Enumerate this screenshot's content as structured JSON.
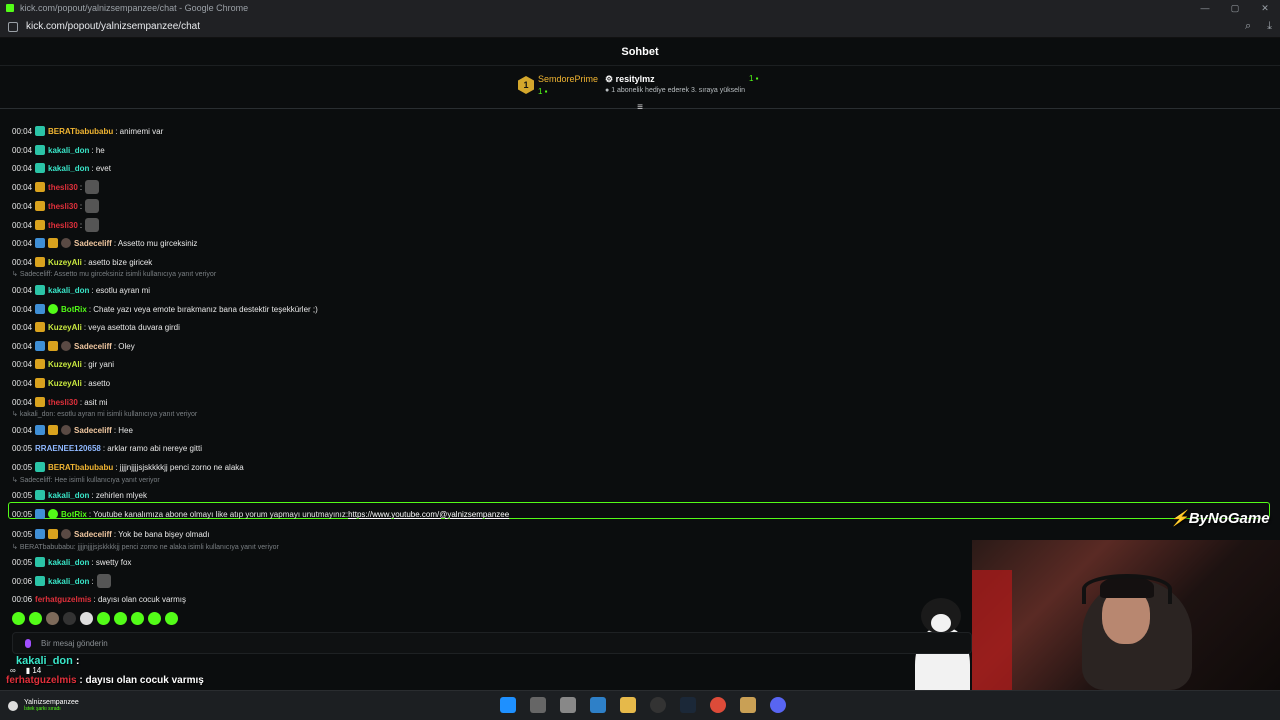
{
  "window": {
    "title": "kick.com/popout/yalnizsempanzee/chat - Google Chrome"
  },
  "browser": {
    "url": "kick.com/popout/yalnizsempanzee/chat",
    "zoom_icon": "zoom-icon",
    "download_icon": "download-icon"
  },
  "chat": {
    "title": "Sohbet",
    "pinned": {
      "rank": "1",
      "first_user": "SemdorePrime",
      "first_count": "1",
      "second_user": "resitylmz",
      "second_count": "1",
      "gift_hint": "1 abonelik hediye ederek 3. sıraya yükselin"
    },
    "messages": [
      {
        "time": "00:04",
        "user": "BERATbabubabu",
        "color": "#f1b532",
        "text": ": animemi var",
        "badges": [
          "sub"
        ]
      },
      {
        "time": "00:04",
        "user": "kakali_don",
        "color": "#39e6c9",
        "text": ": he",
        "badges": [
          "sub"
        ]
      },
      {
        "time": "00:04",
        "user": "kakali_don",
        "color": "#39e6c9",
        "text": ": evet",
        "badges": [
          "sub"
        ]
      },
      {
        "time": "00:04",
        "user": "thesli30",
        "color": "#e0303b",
        "text": ":",
        "badges": [
          "crown"
        ],
        "emote": true
      },
      {
        "time": "00:04",
        "user": "thesli30",
        "color": "#e0303b",
        "text": ":",
        "badges": [
          "crown"
        ],
        "emote": true
      },
      {
        "time": "00:04",
        "user": "thesli30",
        "color": "#e0303b",
        "text": ":",
        "badges": [
          "crown"
        ],
        "emote": true
      },
      {
        "time": "00:04",
        "user": "Sadeceliff",
        "color": "#f0c7a0",
        "text": ": Assetto mu girceksiniz",
        "badges": [
          "mod",
          "crown",
          "av"
        ]
      },
      {
        "time": "00:04",
        "user": "KuzeyAli",
        "color": "#c8e83f",
        "text": ": asetto bize giricek",
        "badges": [
          "crown"
        ]
      },
      {
        "time": "00:04",
        "user": "kakali_don",
        "color": "#39e6c9",
        "text": ": esotlu ayran mi",
        "badges": [
          "sub"
        ]
      },
      {
        "time": "00:04",
        "user": "BotRix",
        "color": "#53fc18",
        "text": ": Chate yazı veya emote bırakmanız bana destektir teşekkürler ;)",
        "badges": [
          "mod",
          "bot"
        ]
      },
      {
        "time": "00:04",
        "user": "KuzeyAli",
        "color": "#c8e83f",
        "text": ": veya asettota duvara girdi",
        "badges": [
          "crown"
        ]
      },
      {
        "time": "00:04",
        "user": "Sadeceliff",
        "color": "#f0c7a0",
        "text": ": Oley",
        "badges": [
          "mod",
          "crown",
          "av"
        ]
      },
      {
        "time": "00:04",
        "user": "KuzeyAli",
        "color": "#c8e83f",
        "text": ": gir yani",
        "badges": [
          "crown"
        ]
      },
      {
        "time": "00:04",
        "user": "KuzeyAli",
        "color": "#c8e83f",
        "text": ": asetto",
        "badges": [
          "crown"
        ]
      },
      {
        "time": "00:04",
        "user": "thesli30",
        "color": "#e0303b",
        "text": ": asit mi",
        "badges": [
          "crown"
        ]
      },
      {
        "time": "00:04",
        "user": "Sadeceliff",
        "color": "#f0c7a0",
        "text": ": Hee",
        "badges": [
          "mod",
          "crown",
          "av"
        ]
      },
      {
        "time": "00:05",
        "user": "RRAENEE120658",
        "color": "#8fb8ff",
        "text": ": arklar ramo abi nereye gitti",
        "badges": []
      },
      {
        "time": "00:05",
        "user": "BERATbabubabu",
        "color": "#f1b532",
        "text": ": jjjjnjjjjsjskkkkjj penci zorno ne alaka",
        "badges": [
          "sub"
        ]
      },
      {
        "time": "00:05",
        "user": "kakali_don",
        "color": "#39e6c9",
        "text": ": zehirlen mlyek",
        "badges": [
          "sub"
        ]
      },
      {
        "time": "00:05",
        "user": "BotRix",
        "color": "#53fc18",
        "text": ": Youtube kanalımıza abone olmayı like atıp yorum yapmayı unutmayınız: ",
        "badges": [
          "mod",
          "bot"
        ],
        "link": "https://www.youtube.com/@yalnizsempanzee"
      },
      {
        "time": "00:05",
        "user": "Sadeceliff",
        "color": "#f0c7a0",
        "text": ": Yok be bana bişey olmadı",
        "badges": [
          "mod",
          "crown",
          "av"
        ]
      },
      {
        "time": "00:05",
        "user": "kakali_don",
        "color": "#39e6c9",
        "text": ": swetty fox",
        "badges": [
          "sub"
        ]
      },
      {
        "time": "00:06",
        "user": "kakali_don",
        "color": "#39e6c9",
        "text": ":",
        "badges": [
          "sub"
        ],
        "emote": true
      },
      {
        "time": "00:06",
        "user": "ferhatguzelmis",
        "color": "#e0303b",
        "text": ": dayısı olan cocuk varmış",
        "badges": []
      }
    ],
    "replies": [
      "Sadeceliff: Assetto mu girceksiniz isimli kullanıcıya yanıt veriyor",
      "kakali_don: esotlu ayran mi isimli kullanıcıya yanıt veriyor",
      "Sadeceliff: Hee isimli kullanıcıya yanıt veriyor",
      "BERATbabubabu: jjjjnjjjjsjskkkkjj penci zorno ne alaka isimli kullanıcıya yanıt veriyor"
    ],
    "input_placeholder": "Bir mesaj gönderin"
  },
  "overlay": {
    "line1_user": "kakali_don",
    "line1_sep": " :",
    "line2_user": "ferhatguzelmis",
    "line2_text": " : dayısı olan cocuk varmış",
    "stat_infinity": "∞",
    "stat_count": "14",
    "logo": "ByNoGame"
  },
  "taskbar": {
    "now_playing_title": "Yalnizsempanzee",
    "now_playing_sub": "İstek şarkı sıradı"
  }
}
